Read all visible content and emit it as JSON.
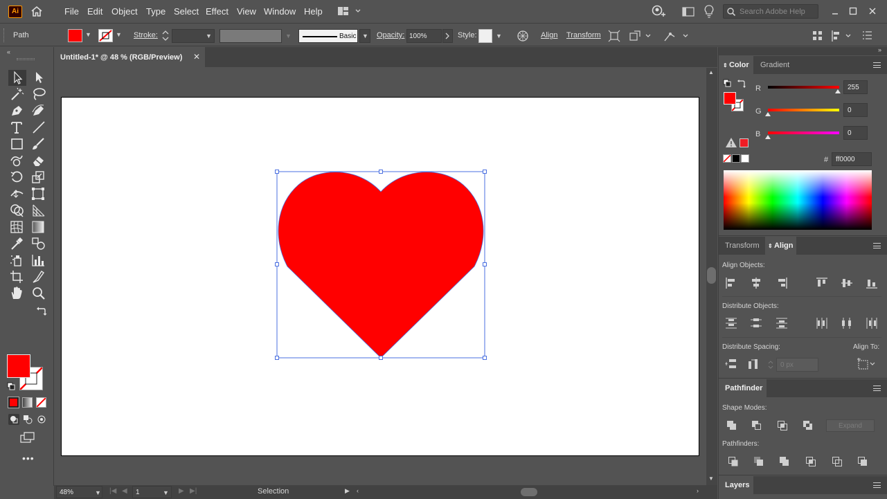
{
  "app": {
    "logo": "Ai"
  },
  "menu": [
    "File",
    "Edit",
    "Object",
    "Type",
    "Select",
    "Effect",
    "View",
    "Window",
    "Help"
  ],
  "search": {
    "placeholder": "Search Adobe Help"
  },
  "control_bar": {
    "object_type": "Path",
    "stroke_label": "Stroke:",
    "brush_label": "Basic",
    "opacity_label": "Opacity:",
    "opacity_value": "100%",
    "style_label": "Style:",
    "align_label": "Align",
    "transform_label": "Transform"
  },
  "document": {
    "tab_title": "Untitled-1* @ 48 % (RGB/Preview)"
  },
  "colors": {
    "fill": "#ff0000",
    "selection": "#4a6fe0",
    "bg": "#535353"
  },
  "color_panel": {
    "tabs": [
      "Color",
      "Gradient"
    ],
    "r_label": "R",
    "r_value": "255",
    "g_label": "G",
    "g_value": "0",
    "b_label": "B",
    "b_value": "0",
    "r_level": 1.0,
    "g_level": 0.0,
    "b_level": 0.0,
    "hex_symbol": "#",
    "hex_value": "ff0000"
  },
  "align_panel": {
    "tabs": [
      "Transform",
      "Align"
    ],
    "align_objects_label": "Align Objects:",
    "distribute_objects_label": "Distribute Objects:",
    "distribute_spacing_label": "Distribute Spacing:",
    "align_to_label": "Align To:",
    "spacing_value": "0 px"
  },
  "pathfinder_panel": {
    "title": "Pathfinder",
    "shape_modes_label": "Shape Modes:",
    "expand_label": "Expand",
    "pathfinders_label": "Pathfinders:"
  },
  "layers_panel": {
    "title": "Layers"
  },
  "status_bar": {
    "zoom": "48%",
    "artboard_number": "1",
    "tool": "Selection"
  }
}
